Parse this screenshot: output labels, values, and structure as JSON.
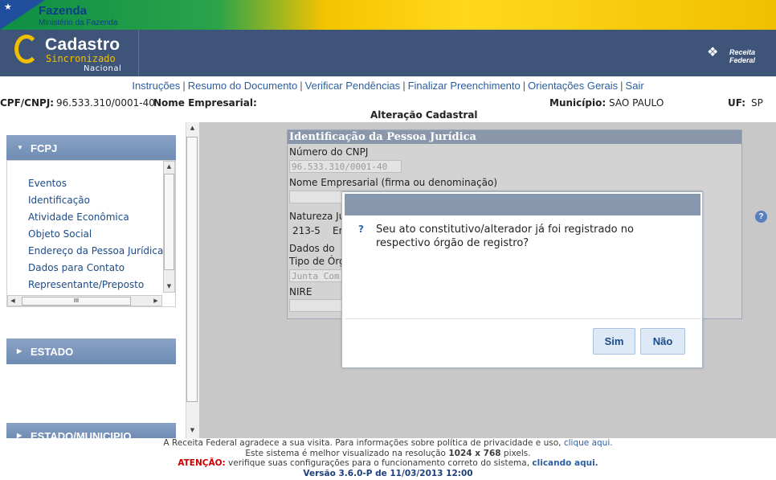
{
  "header": {
    "fazenda_title": "Fazenda",
    "fazenda_subtitle": "Ministério da Fazenda",
    "logo_line1": "Cadastro",
    "logo_line2": "Sincronizado",
    "logo_line3": "Nacional",
    "receita_logo": "Receita Federal"
  },
  "nav": {
    "items": [
      "Instruções",
      "Resumo do Documento",
      "Verificar Pendências",
      "Finalizar Preenchimento",
      "Orientações Gerais",
      "Sair"
    ]
  },
  "info": {
    "cnpj_label": "CPF/CNPJ:",
    "cnpj_value": "96.533.310/0001-40",
    "nome_label": "Nome Empresarial:",
    "municipio_label": "Município:",
    "municipio_value": "SAO PAULO",
    "uf_label": "UF:",
    "uf_value": "SP",
    "page_title": "Alteração Cadastral"
  },
  "sidebar": {
    "sections": [
      "FCPJ",
      "ESTADO",
      "ESTADO/MUNICIPIO"
    ],
    "fcpj_items": [
      "Eventos",
      "Identificação",
      "Atividade Econômica",
      "Objeto Social",
      "Endereço da Pessoa Jurídica",
      "Dados para Contato",
      "Representante/Preposto"
    ],
    "hscroll_thumb": "III"
  },
  "form": {
    "title": "Identificação da Pessoa Jurídica",
    "cnpj_label": "Número do CNPJ",
    "cnpj_value": "96.533.310/0001-40",
    "nome_label": "Nome Empresarial (firma ou denominação)",
    "natureza_label": "Natureza Ju",
    "natureza_code": "213-5",
    "natureza_text": "Em",
    "dados_label": "Dados do",
    "tipo_label": "Tipo de Órg",
    "tipo_value": "Junta Com",
    "nire_label": "NIRE"
  },
  "dialog": {
    "icon": "?",
    "message": "Seu ato constitutivo/alterador já foi registrado no respectivo órgão de registro?",
    "yes_label": "Sim",
    "no_label": "Não"
  },
  "help_icon": "?",
  "footer": {
    "line1_text": "A Receita Federal agradece a sua visita. Para informações sobre política de privacidade e uso,",
    "line1_link": "clique aqui.",
    "line2_pre": "Este sistema é melhor visualizado na resolução",
    "line2_bold": "1024 x 768",
    "line2_post": "pixels.",
    "line3_attention": "ATENÇÃO:",
    "line3_text": "verifique suas configurações para o funcionamento correto do sistema,",
    "line3_link": "clicando aqui.",
    "version": "Versão 3.6.0-P de 11/03/2013 12:00"
  },
  "colors": {
    "header_bg": "#3e5579",
    "accent_yellow": "#f0c000",
    "link_blue": "#2d5fa0",
    "accordion_blue": "#7e97bb",
    "dialog_header": "#8797ad",
    "attention_red": "#cc0000"
  }
}
